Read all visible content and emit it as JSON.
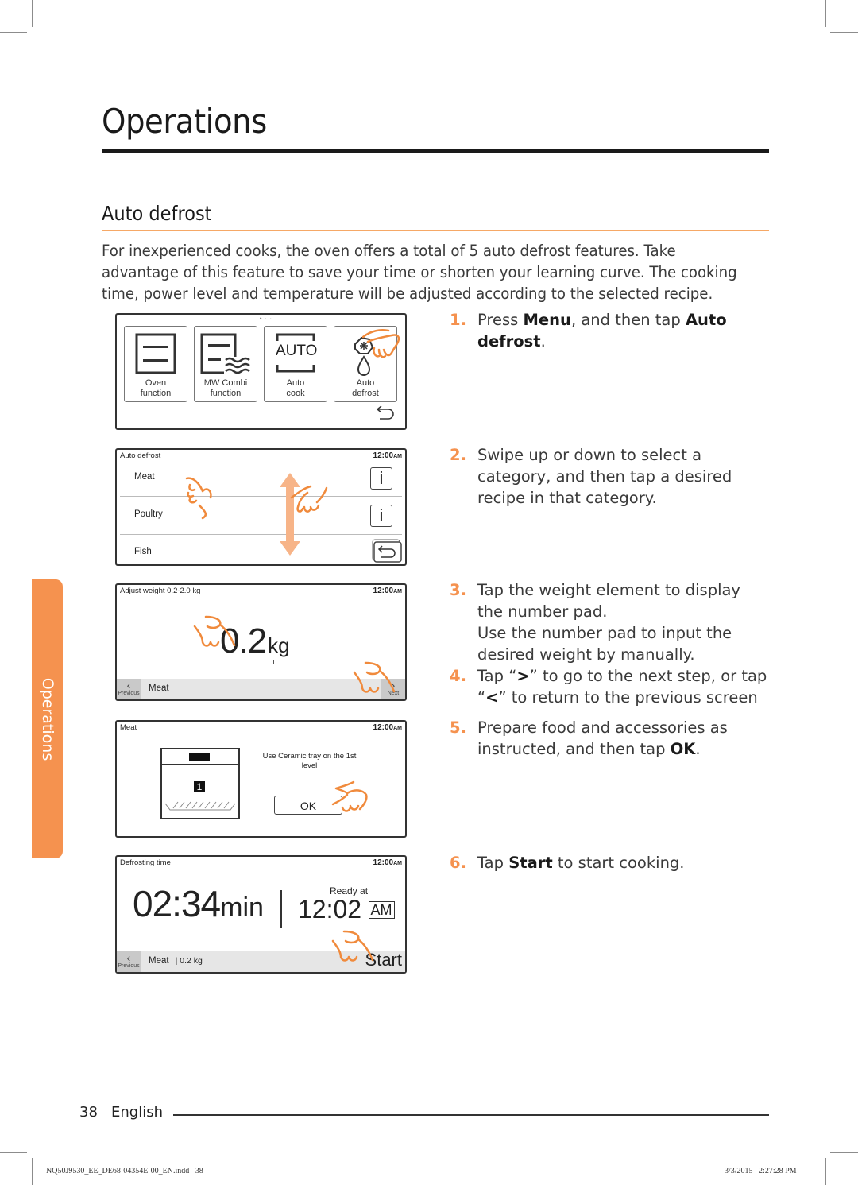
{
  "header": {
    "chapter_title": "Operations",
    "section_title": "Auto defrost",
    "intro": "For inexperienced cooks, the oven offers a total of 5 auto defrost features. Take advantage of this feature to save your time or shorten your learning curve. The cooking time, power level and temperature will be adjusted according to the selected recipe."
  },
  "side_tab": {
    "label": "Operations",
    "color": "#f5924f"
  },
  "colors": {
    "accent": "#f5924f",
    "section_rule": "#f6a866",
    "hand": "#f08a3c"
  },
  "steps": [
    {
      "num": "1.",
      "parts": [
        "Press ",
        "Menu",
        ", and then tap ",
        "Auto defrost",
        "."
      ]
    },
    {
      "num": "2.",
      "text": "Swipe up or down to select a category, and then tap a desired recipe in that category."
    },
    {
      "num": "3.",
      "text": "Tap the weight element to display the number pad.",
      "text2": "Use the number pad to input the desired weight by manually."
    },
    {
      "num": "4.",
      "parts": [
        "Tap “",
        ">",
        "” to go to the next step, or tap “",
        "<",
        "” to return to the previous screen"
      ]
    },
    {
      "num": "5.",
      "parts": [
        "Prepare food and accessories as instructed, and then tap ",
        "OK",
        "."
      ]
    },
    {
      "num": "6.",
      "parts": [
        "Tap ",
        "Start",
        " to start cooking."
      ]
    }
  ],
  "screens": {
    "menu": {
      "page_indicator": "• · ·",
      "tiles": [
        {
          "line1": "Oven",
          "line2": "function",
          "icon": "oven-icon"
        },
        {
          "line1": "MW Combi",
          "line2": "function",
          "icon": "mw-combi-icon"
        },
        {
          "line1": "Auto",
          "line2": "cook",
          "icon": "auto-cook-icon",
          "icon_text": "AUTO"
        },
        {
          "line1": "Auto",
          "line2": "defrost",
          "icon": "defrost-icon"
        }
      ]
    },
    "category": {
      "title": "Auto defrost",
      "clock": "12:00",
      "clock_suffix": "AM",
      "items": [
        "Meat",
        "Poultry",
        "Fish"
      ],
      "info_glyph": "i"
    },
    "weight": {
      "title": "Adjust weight 0.2-2.0 kg",
      "clock": "12:00",
      "clock_suffix": "AM",
      "value": "0.2",
      "unit": "kg",
      "bar_label": "Meat",
      "prev_label": "Previous",
      "next_label": "Next"
    },
    "accessory": {
      "title": "Meat",
      "clock": "12:00",
      "clock_suffix": "AM",
      "instruction": "Use Ceramic tray on the 1st level",
      "level": "1",
      "ok_label": "OK"
    },
    "time": {
      "title": "Defrosting time",
      "clock": "12:00",
      "clock_suffix": "AM",
      "duration": "02:34",
      "duration_unit": "min",
      "ready_label": "Ready at",
      "ready_time": "12:02",
      "ready_suffix": "AM",
      "bar_label": "Meat",
      "bar_weight": "| 0.2 kg",
      "prev_label": "Previous",
      "start_label": "Start"
    }
  },
  "footer": {
    "page_number": "38",
    "language": "English",
    "file_name": "NQ50J9530_EE_DE68-04354E-00_EN.indd   38",
    "timestamp": "3/3/2015   2:27:28 PM"
  }
}
